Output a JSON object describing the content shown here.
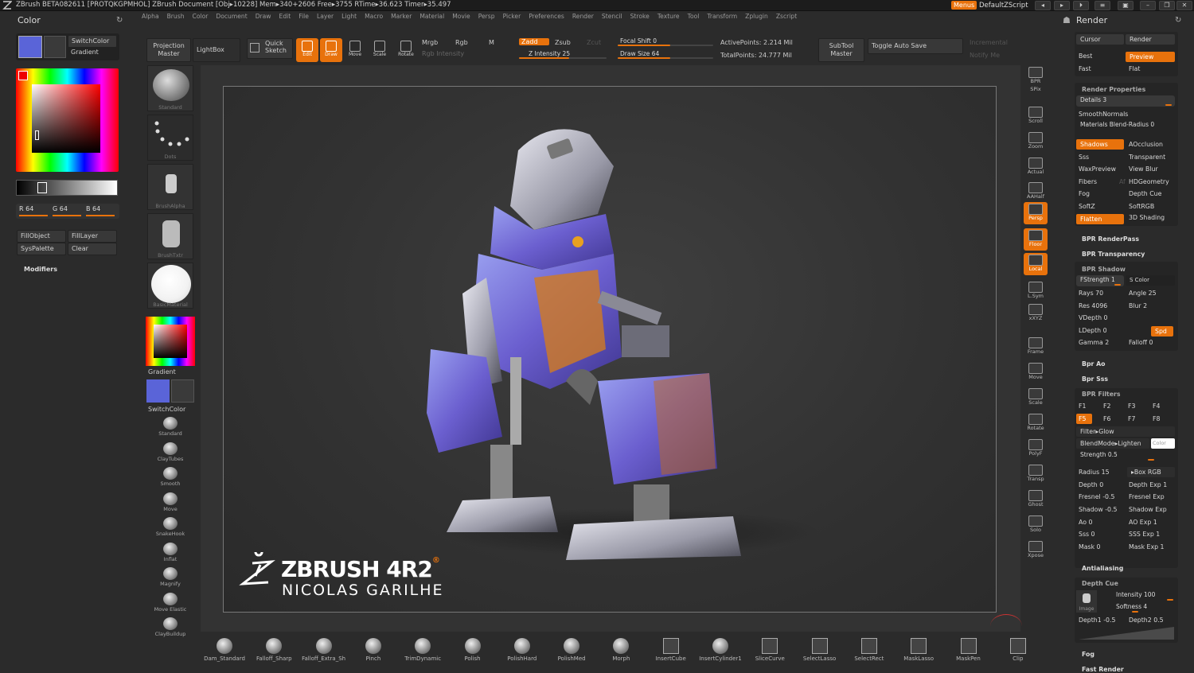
{
  "titlebar": {
    "text": "ZBrush BETA082611 [PROTQKGPMHOL]    ZBrush Document     [Obj▸10228] Mem▸340+2606 Free▸3755 RTime▸36.623 Timer▸35.497",
    "menus_btn": "Menus",
    "script": "DefaultZScript"
  },
  "menubar": [
    "Alpha",
    "Brush",
    "Color",
    "Document",
    "Draw",
    "Edit",
    "File",
    "Layer",
    "Light",
    "Macro",
    "Marker",
    "Material",
    "Movie",
    "Persp",
    "Picker",
    "Preferences",
    "Render",
    "Stencil",
    "Stroke",
    "Texture",
    "Tool",
    "Transform",
    "Zplugin",
    "Zscript"
  ],
  "left": {
    "title": "Color",
    "switch_color": "SwitchColor",
    "gradient": "Gradient",
    "r": "R 64",
    "g": "G 64",
    "b": "B 64",
    "fill_object": "FillObject",
    "fill_layer": "FillLayer",
    "sys_palette": "SysPalette",
    "clear": "Clear",
    "modifiers": "Modifiers",
    "main_color": "#5a64d8",
    "secondary_color": "#3a3a3a"
  },
  "toolbar": {
    "projection_master": "Projection Master",
    "lightbox": "LightBox",
    "quick_sketch": "Quick Sketch",
    "edit": "Edit",
    "draw": "Draw",
    "move": "Move",
    "scale": "Scale",
    "rotate": "Rotate",
    "mrgb": "Mrgb",
    "rgb": "Rgb",
    "m": "M",
    "rgb_intensity": "Rgb Intensity",
    "zadd": "Zadd",
    "zsub": "Zsub",
    "zcut": "Zcut",
    "z_intensity": "Z Intensity 25",
    "focal_shift": "Focal Shift 0",
    "draw_size": "Draw Size 64",
    "active_points": "ActivePoints: 2.214 Mil",
    "total_points": "TotalPoints: 24.777 Mil",
    "subtool_master": "SubTool Master",
    "toggle_auto_save": "Toggle Auto Save",
    "incremental": "Incremental",
    "notify_me": "Notify Me"
  },
  "brushes": {
    "standard": "Standard",
    "dots": "Dots",
    "brush_alpha": "BrushAlpha",
    "brush_txtr": "BrushTxtr",
    "basic_material": "BasicMaterial",
    "gradient": "Gradient",
    "switch_color": "SwitchColor",
    "list": [
      "Standard",
      "ClayTubes",
      "Smooth",
      "Move",
      "SnakeHook",
      "Inflat",
      "Magnify",
      "Move Elastic",
      "ClayBuildup"
    ]
  },
  "canvas": {
    "logo_main": "ZBRUSH 4R2",
    "logo_sub": "NICOLAS GARILHE"
  },
  "right_strip": [
    "BPR",
    "SPix",
    "Scroll",
    "Zoom",
    "Actual",
    "AAHalf",
    "Persp",
    "Floor",
    "Local",
    "L.Sym",
    "xXYZ",
    "Frame",
    "Move",
    "Scale",
    "Rotate",
    "PolyF",
    "Transp",
    "Ghost",
    "Solo",
    "Xpose"
  ],
  "render": {
    "title": "Render",
    "cursor": "Cursor",
    "render": "Render",
    "best": "Best",
    "preview": "Preview",
    "fast": "Fast",
    "flat": "Flat",
    "render_properties": "Render Properties",
    "details": "Details 3",
    "smooth_normals": "SmoothNormals",
    "materials_blend": "Materials Blend-Radius 0",
    "shadows": "Shadows",
    "aocclusion": "AOcclusion",
    "sss": "Sss",
    "transparent": "Transparent",
    "waxpreview": "WaxPreview",
    "view_blur": "View Blur",
    "fibers": "Fibers",
    "af": "Af",
    "hdgeometry": "HDGeometry",
    "fog": "Fog",
    "depth_cue": "Depth Cue",
    "softz": "SoftZ",
    "softrgb": "SoftRGB",
    "flatten": "Flatten",
    "shading_3d": "3D Shading",
    "bpr_renderpass": "BPR RenderPass",
    "bpr_transparency": "BPR Transparency",
    "bpr_shadow": "BPR Shadow",
    "fstrength": "FStrength 1",
    "s_color": "S Color",
    "rays": "Rays 70",
    "angle": "Angle 25",
    "res": "Res 4096",
    "blur": "Blur 2",
    "vdepth": "VDepth 0",
    "ldepth": "LDepth 0",
    "spd": "Spd",
    "gamma": "Gamma 2",
    "falloff": "Falloff 0",
    "bpr_ao": "Bpr Ao",
    "bpr_sss": "Bpr Sss",
    "bpr_filters": "BPR Filters",
    "f1": "F1",
    "f2": "F2",
    "f3": "F3",
    "f4": "F4",
    "f5": "F5",
    "f6": "F6",
    "f7": "F7",
    "f8": "F8",
    "filter": "Filter▸Glow",
    "blendmode": "BlendMode▸Lighten",
    "color": "Color",
    "strength": "Strength 0.5",
    "radius": "Radius 15",
    "box_rgb": "▸Box RGB",
    "depth": "Depth 0",
    "depth_exp": "Depth Exp 1",
    "fresnel": "Fresnel -0.5",
    "fresnel_exp": "Fresnel Exp",
    "shadow": "Shadow -0.5",
    "shadow_exp": "Shadow Exp",
    "ao": "Ao 0",
    "ao_exp": "AO Exp 1",
    "sss2": "Sss 0",
    "sss_exp": "SSS Exp 1",
    "mask": "Mask 0",
    "mask_exp": "Mask Exp 1",
    "antialiasing": "Antialiasing",
    "depth_cue2": "Depth Cue",
    "intensity": "Intensity 100",
    "image": "Image",
    "softness": "Softness 4",
    "depth1": "Depth1 -0.5",
    "depth2": "Depth2 0.5",
    "fog2": "Fog",
    "fast_render": "Fast Render"
  },
  "bottom": [
    "Dam_Standard",
    "Falloff_Sharp",
    "Falloff_Extra_Sh",
    "Pinch",
    "TrimDynamic",
    "Polish",
    "PolishHard",
    "PolishMed",
    "Morph",
    "InsertCube",
    "InsertCylinder1",
    "SliceCurve",
    "SelectLasso",
    "SelectRect",
    "MaskLasso",
    "MaskPen",
    "Clip"
  ]
}
